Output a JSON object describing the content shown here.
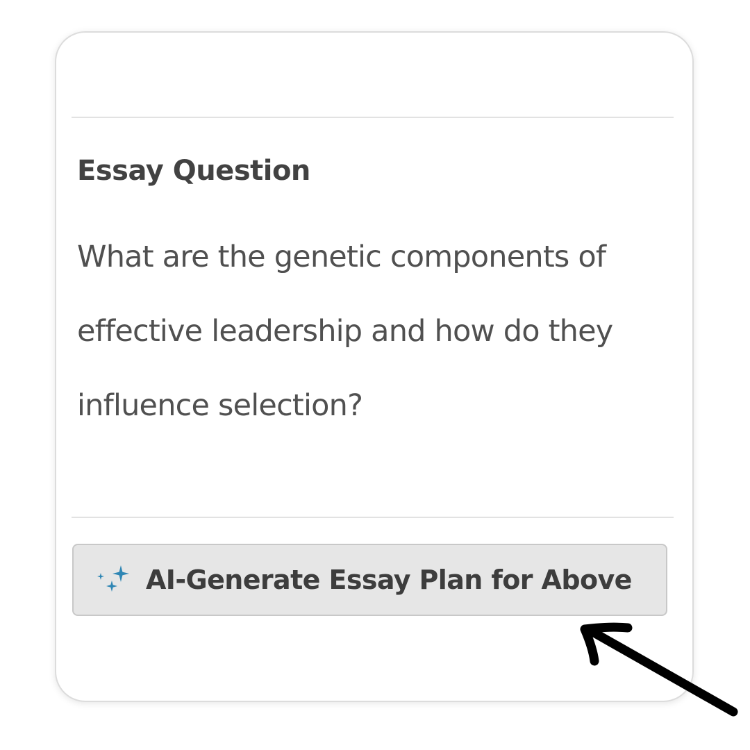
{
  "essay": {
    "heading": "Essay Question",
    "question": "What are the genetic components of effective leadership and how do they influence selection?"
  },
  "action_button": {
    "label": "AI-Generate Essay Plan for Above",
    "icon": "sparkle-icon"
  },
  "colors": {
    "sparkle": "#2f86b4",
    "button_bg": "#e6e6e6",
    "text": "#505050"
  }
}
